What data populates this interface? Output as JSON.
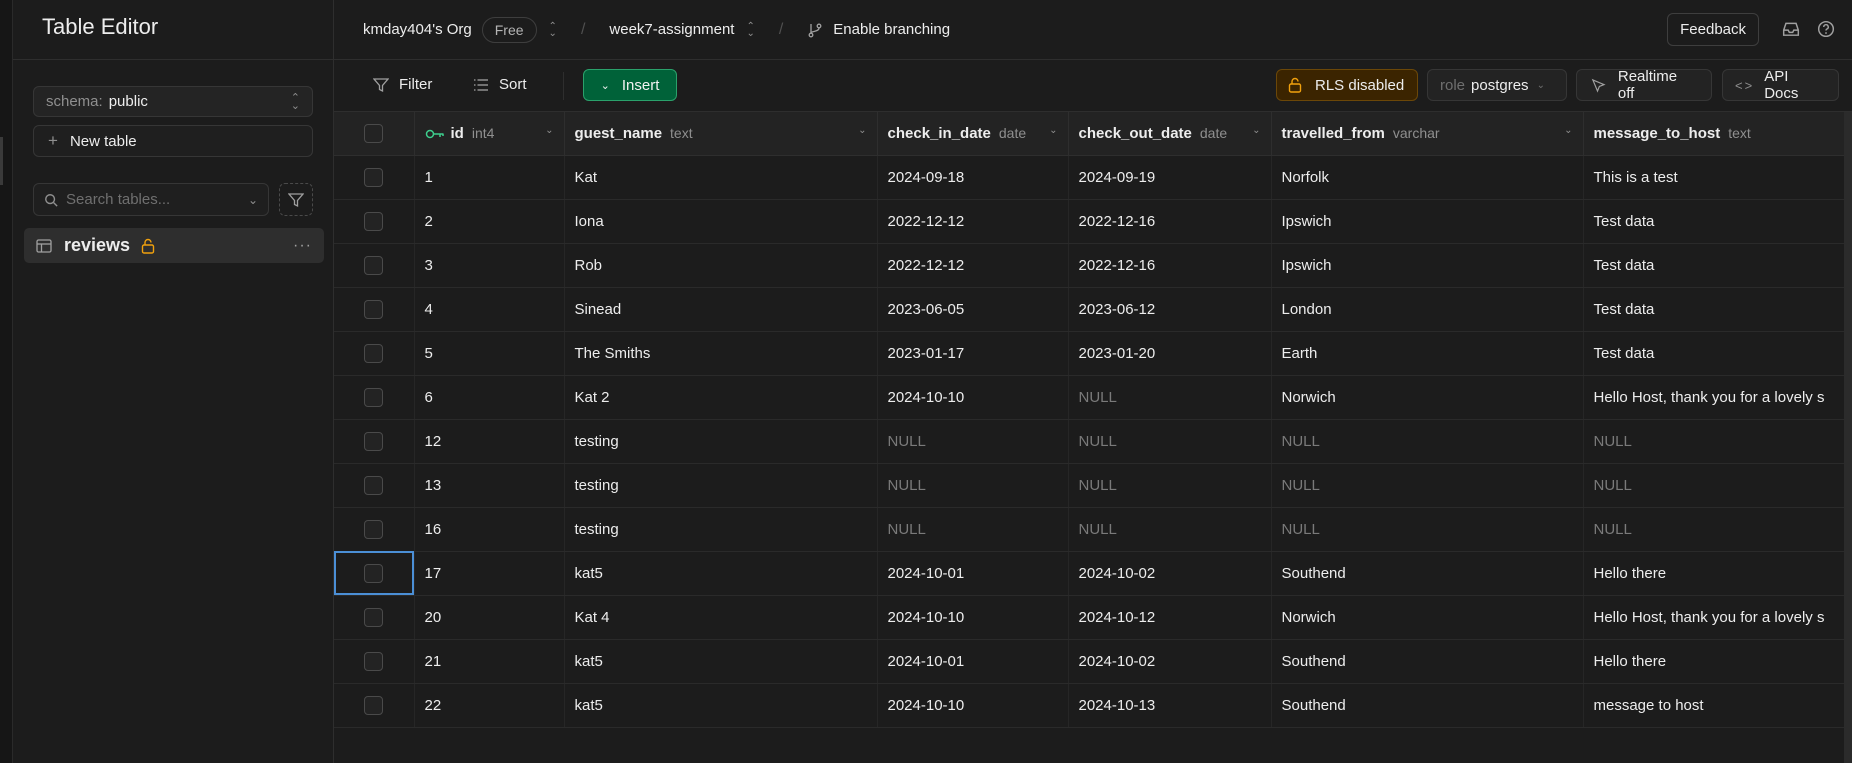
{
  "sidebar": {
    "title": "Table Editor",
    "schema_prefix": "schema:",
    "schema_value": "public",
    "new_table_label": "New table",
    "search_placeholder": "Search tables...",
    "tables": [
      {
        "name": "reviews",
        "lock_icon": "unlock-icon"
      }
    ]
  },
  "topbar": {
    "org": "kmday404's Org",
    "plan": "Free",
    "project": "week7-assignment",
    "branching": "Enable branching",
    "feedback": "Feedback"
  },
  "toolbar": {
    "filter": "Filter",
    "sort": "Sort",
    "insert": "Insert",
    "rls": "RLS disabled",
    "role_prefix": "role",
    "role_value": "postgres",
    "realtime": "Realtime off",
    "api_docs": "API Docs"
  },
  "grid": {
    "columns": [
      {
        "name": "id",
        "type": "int4",
        "primary_key": true
      },
      {
        "name": "guest_name",
        "type": "text"
      },
      {
        "name": "check_in_date",
        "type": "date"
      },
      {
        "name": "check_out_date",
        "type": "date"
      },
      {
        "name": "travelled_from",
        "type": "varchar"
      },
      {
        "name": "message_to_host",
        "type": "text"
      }
    ],
    "null_label": "NULL",
    "rows": [
      [
        "1",
        "Kat",
        "2024-09-18",
        "2024-09-19",
        "Norfolk",
        "This is a test"
      ],
      [
        "2",
        "Iona",
        "2022-12-12",
        "2022-12-16",
        "Ipswich",
        "Test data"
      ],
      [
        "3",
        "Rob",
        "2022-12-12",
        "2022-12-16",
        "Ipswich",
        "Test data"
      ],
      [
        "4",
        "Sinead",
        "2023-06-05",
        "2023-06-12",
        "London",
        "Test data"
      ],
      [
        "5",
        "The Smiths",
        "2023-01-17",
        "2023-01-20",
        "Earth",
        "Test data"
      ],
      [
        "6",
        "Kat 2",
        "2024-10-10",
        null,
        "Norwich",
        "Hello Host, thank you for a lovely s"
      ],
      [
        "12",
        "testing",
        null,
        null,
        null,
        null
      ],
      [
        "13",
        "testing",
        null,
        null,
        null,
        null
      ],
      [
        "16",
        "testing",
        null,
        null,
        null,
        null
      ],
      [
        "17",
        "kat5",
        "2024-10-01",
        "2024-10-02",
        "Southend",
        "Hello there"
      ],
      [
        "20",
        "Kat 4",
        "2024-10-10",
        "2024-10-12",
        "Norwich",
        "Hello Host, thank you for a lovely s"
      ],
      [
        "21",
        "kat5",
        "2024-10-01",
        "2024-10-02",
        "Southend",
        "Hello there"
      ],
      [
        "22",
        "kat5",
        "2024-10-10",
        "2024-10-13",
        "Southend",
        "message to host"
      ]
    ],
    "selected_row_index": 9
  },
  "colors": {
    "accent_green": "#3ecf8e",
    "insert_bg": "#006239",
    "rls_warning": "#f1a10d",
    "selection_blue": "#4b8fd6"
  }
}
